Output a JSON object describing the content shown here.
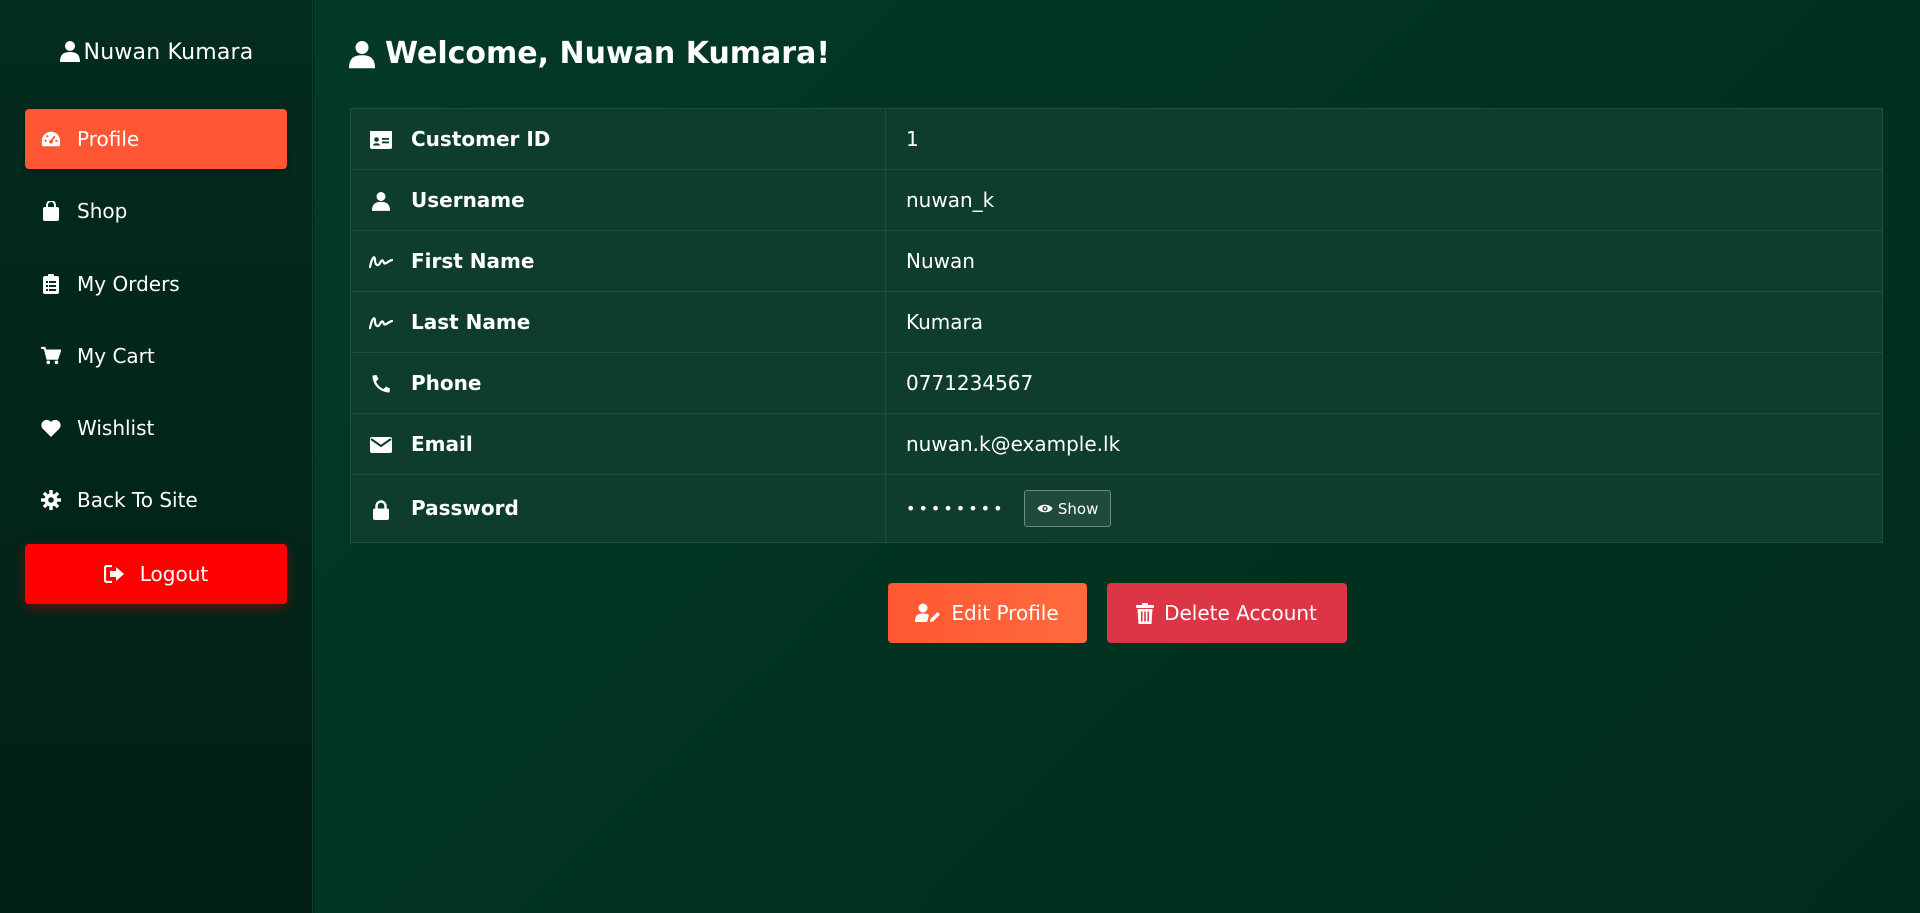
{
  "sidebar": {
    "user_name": "Nuwan Kumara",
    "items": [
      {
        "label": "Profile",
        "icon": "dashboard-icon",
        "active": true
      },
      {
        "label": "Shop",
        "icon": "shopping-bag-icon"
      },
      {
        "label": "My Orders",
        "icon": "clipboard-icon"
      },
      {
        "label": "My Cart",
        "icon": "cart-icon"
      },
      {
        "label": "Wishlist",
        "icon": "heart-icon"
      },
      {
        "label": "Back To Site",
        "icon": "gear-icon"
      }
    ],
    "logout_label": "Logout"
  },
  "main": {
    "welcome": "Welcome, Nuwan Kumara!",
    "rows": [
      {
        "label": "Customer ID",
        "value": "1",
        "icon": "id-card-icon"
      },
      {
        "label": "Username",
        "value": "nuwan_k",
        "icon": "user-icon"
      },
      {
        "label": "First Name",
        "value": "Nuwan",
        "icon": "signature-icon"
      },
      {
        "label": "Last Name",
        "value": "Kumara",
        "icon": "signature-icon"
      },
      {
        "label": "Phone",
        "value": "0771234567",
        "icon": "phone-icon"
      },
      {
        "label": "Email",
        "value": "nuwan.k@example.lk",
        "icon": "envelope-icon"
      },
      {
        "label": "Password",
        "value": "••••••••",
        "icon": "lock-icon"
      }
    ],
    "show_label": "Show",
    "edit_label": "Edit Profile",
    "delete_label": "Delete Account"
  },
  "colors": {
    "accent": "#ff5733",
    "logout": "#ff0000",
    "delete": "#dc3545",
    "background": "#01321f"
  }
}
